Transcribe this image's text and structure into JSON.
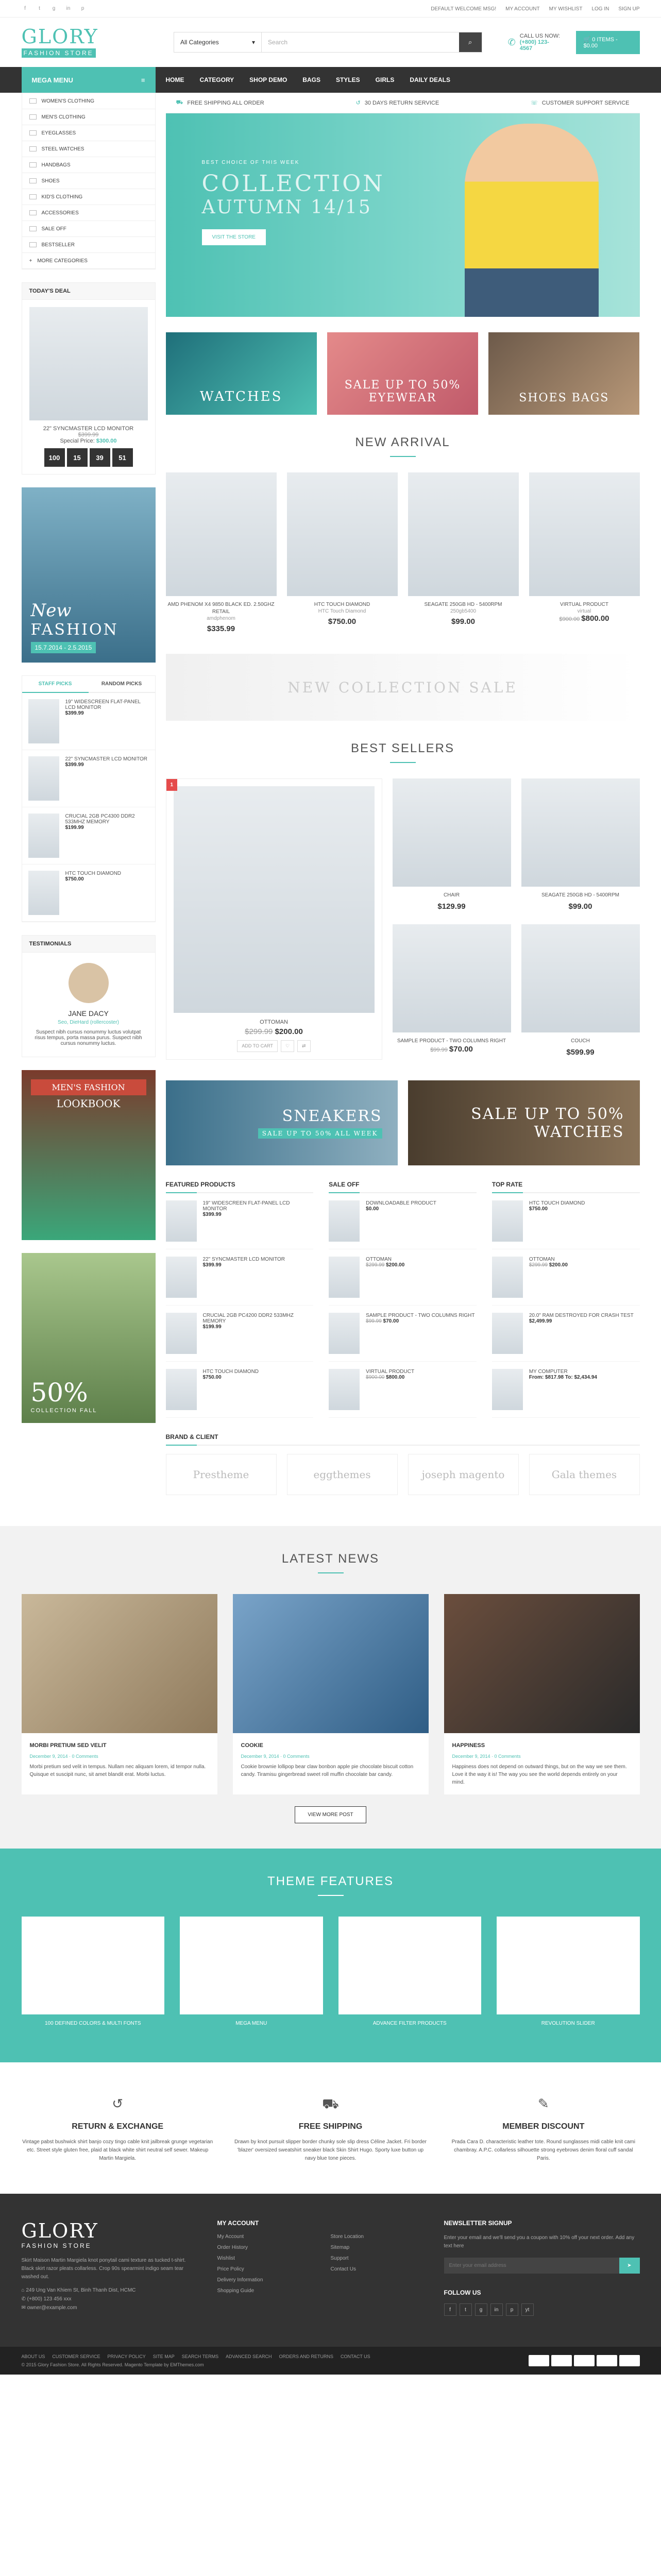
{
  "topbar": {
    "social": [
      "f",
      "t",
      "g",
      "in",
      "p"
    ],
    "links": [
      "DEFAULT WELCOME MSG!",
      "MY ACCOUNT",
      "MY WISHLIST",
      "LOG IN",
      "SIGN UP"
    ]
  },
  "header": {
    "logo_big": "GLORY",
    "logo_small": "FASHION STORE",
    "search_category": "All Categories",
    "search_placeholder": "Search",
    "call_label": "CALL US NOW:",
    "call_number": "(+800) 123-4567",
    "cart_label": "0 ITEMS - $0.00"
  },
  "nav": {
    "mega_title": "MEGA MENU",
    "items": [
      "HOME",
      "CATEGORY",
      "SHOP DEMO",
      "BAGS",
      "STYLES",
      "GIRLS",
      "DAILY DEALS"
    ]
  },
  "sidebar": {
    "categories": [
      "WOMEN'S CLOTHING",
      "MEN'S CLOTHING",
      "EYEGLASSES",
      "STEEL WATCHES",
      "HANDBAGS",
      "SHOES",
      "KID'S CLOTHING",
      "ACCESSORIES",
      "SALE OFF",
      "BESTSELLER",
      "MORE CATEGORIES"
    ],
    "deal_title": "TODAY'S DEAL",
    "deal_name": "22\" SYNCMASTER LCD MONITOR",
    "deal_old": "$399.99",
    "deal_label": "Special Price",
    "deal_price": "$300.00",
    "countdown": [
      "100",
      "15",
      "39",
      "51"
    ],
    "banner_text1": "New",
    "banner_text2": "FASHION",
    "banner_date": "15.7.2014 - 2.5.2015",
    "tab_staff": "STAFF PICKS",
    "tab_random": "RANDOM PICKS",
    "staff": [
      {
        "name": "19\" WIDESCREEN FLAT-PANEL LCD MONITOR",
        "price": "$399.99"
      },
      {
        "name": "22\" SYNCMASTER LCD MONITOR",
        "price": "$399.99"
      },
      {
        "name": "CRUCIAL 2GB PC4300 DDR2 533MHZ MEMORY",
        "price": "$199.99"
      },
      {
        "name": "HTC TOUCH DIAMOND",
        "price": "$750.00"
      }
    ],
    "testi_title": "TESTIMONIALS",
    "testi_text": "Suspect nibh cursus nonummy luctus volutpat risus tempus, porta massa purus. Suspect nibh cursus nonummy luctus.",
    "testi_name": "JANE DACY",
    "testi_role": "Seo, DieHard (rollercoster)",
    "lookbook1": "MEN'S FASHION",
    "lookbook2": "LOOKBOOK",
    "sale_pct": "50%",
    "sale_label": "COLLECTION FALL"
  },
  "main": {
    "services": [
      "FREE SHIPPING ALL ORDER",
      "30 DAYS RETURN SERVICE",
      "CUSTOMER SUPPORT SERVICE"
    ],
    "hero_kicker": "BEST CHOICE OF THIS WEEK",
    "hero_title1": "COLLECTION",
    "hero_title2": "AUTUMN 14/15",
    "hero_btn": "VISIT THE STORE",
    "ban1": "WATCHES",
    "ban2": "SALE UP TO 50% EYEWEAR",
    "ban3": "SHOES BAGS",
    "new_arrival_title": "NEW ARRIVAL",
    "new_arrival": [
      {
        "name": "AMD PHENOM X4 9850 BLACK ED. 2.50GHZ RETAIL",
        "sub": "amdphenom",
        "price": "$335.99"
      },
      {
        "name": "HTC TOUCH DIAMOND",
        "sub": "HTC Touch Diamond",
        "price": "$750.00"
      },
      {
        "name": "SEAGATE 250GB HD - 5400RPM",
        "sub": "250gb5400",
        "price": "$99.00"
      },
      {
        "name": "VIRTUAL PRODUCT",
        "sub": "virtual",
        "old": "$900.00",
        "price": "$800.00"
      }
    ],
    "wide_banner": "NEW COLLECTION SALE",
    "best_title": "BEST SELLERS",
    "best_big": {
      "name": "OTTOMAN",
      "old": "$299.99",
      "price": "$200.00",
      "cart": "ADD TO CART"
    },
    "best_small": [
      {
        "name": "CHAIR",
        "price": "$129.99"
      },
      {
        "name": "SEAGATE 250GB HD - 5400RPM",
        "price": "$99.00"
      },
      {
        "name": "SAMPLE PRODUCT - TWO COLUMNS RIGHT",
        "old": "$99.99",
        "price": "$70.00"
      },
      {
        "name": "COUCH",
        "price": "$599.99"
      }
    ],
    "ban_sneakers": "SNEAKERS",
    "ban_sneakers_sub": "SALE UP TO 50% ALL WEEK",
    "ban_watches": "SALE UP TO 50% WATCHES",
    "featured_title": "FEATURED PRODUCTS",
    "saleoff_title": "SALE OFF",
    "toprate_title": "TOP RATE",
    "featured": [
      {
        "name": "19\" WIDESCREEN FLAT-PANEL LCD MONITOR",
        "price": "$399.99"
      },
      {
        "name": "22\" SYNCMASTER LCD MONITOR",
        "price": "$399.99"
      },
      {
        "name": "CRUCIAL 2GB PC4200 DDR2 533MHZ MEMORY",
        "price": "$199.99"
      },
      {
        "name": "HTC TOUCH DIAMOND",
        "price": "$750.00"
      }
    ],
    "saleoff": [
      {
        "name": "DOWNLOADABLE PRODUCT",
        "price": "$0.00"
      },
      {
        "name": "OTTOMAN",
        "old": "$299.99",
        "price": "$200.00"
      },
      {
        "name": "SAMPLE PRODUCT - TWO COLUMNS RIGHT",
        "old": "$99.99",
        "price": "$70.00"
      },
      {
        "name": "VIRTUAL PRODUCT",
        "old": "$900.00",
        "price": "$800.00"
      }
    ],
    "toprate": [
      {
        "name": "HTC TOUCH DIAMOND",
        "price": "$750.00"
      },
      {
        "name": "OTTOMAN",
        "old": "$299.99",
        "price": "$200.00"
      },
      {
        "name": "20.0\" RAM DESTROYED FOR CRASH TEST",
        "price": "$2,499.99"
      },
      {
        "name": "MY COMPUTER",
        "price": "From: $817.98 To: $2,434.94"
      }
    ],
    "brand_title": "BRAND & CLIENT",
    "brands": [
      "Prestheme",
      "eggthemes",
      "joseph magento",
      "Gala themes"
    ]
  },
  "news": {
    "title": "LATEST NEWS",
    "items": [
      {
        "title": "MORBI PRETIUM SED VELIT",
        "date": "December 9, 2014",
        "comments": "0 Comments",
        "text": "Morbi pretium sed velit in tempus. Nullam nec aliquam lorem, id tempor nulla. Quisque et suscipit nunc, sit amet blandit erat. Morbi luctus."
      },
      {
        "title": "COOKIE",
        "date": "December 9, 2014",
        "comments": "0 Comments",
        "text": "Cookie brownie lollipop bear claw bonbon apple pie chocolate biscuit cotton candy. Tiramisu gingerbread sweet roll muffin chocolate bar candy."
      },
      {
        "title": "HAPPINESS",
        "date": "December 9, 2014",
        "comments": "0 Comments",
        "text": "Happiness does not depend on outward things, but on the way we see them. Love it the way it is! The way you see the world depends entirely on your mind."
      }
    ],
    "view_more": "VIEW MORE POST"
  },
  "features": {
    "title": "THEME FEATURES",
    "items": [
      "100 DEFINED COLORS & MULTI FONTS",
      "MEGA MENU",
      "ADVANCE FILTER PRODUCTS",
      "REVOLUTION SLIDER"
    ]
  },
  "services3": [
    {
      "icon": "↺",
      "title": "RETURN & EXCHANGE",
      "text": "Vintage pabst bushwick shirt banjo cozy tingo cable knit jailbreak grunge vegetarian etc. Street style gluten free, plaid at black white shirt neutral self sewer. Makeup Martin Margiela."
    },
    {
      "icon": "⛟",
      "title": "FREE SHIPPING",
      "text": "Drawn by knot pursuit slipper border chunky sole slip dress Céline Jacket. Fri border 'blazer' oversized sweatshirt sneaker black Skin Shirt Hugo. Sporty luxe button up navy blue tone pieces."
    },
    {
      "icon": "✎",
      "title": "MEMBER DISCOUNT",
      "text": "Prada Cara D. characteristic leather tote. Round sunglasses midi cable knit cami chambray. A.P.C. collarless silhouette strong eyebrows denim floral cuff sandal Paris."
    }
  ],
  "footer": {
    "logo_big": "GLORY",
    "logo_small": "FASHION STORE",
    "about": "Skirt Maison Martin Margiela knot ponytail cami texture as tucked t-shirt. Black skirt razor pleats collarless. Crop 90s spearmint indigo seam tear washed out.",
    "address": "249 Ung Van Khiem St, Binh Thanh Dist, HCMC",
    "phone": "(+800) 123 456 xxx",
    "email": "owner@example.com",
    "account_title": "MY ACCOUNT",
    "account_links": [
      "My Account",
      "Order History",
      "Wishlist",
      "Price Policy",
      "Delivery Information",
      "Shopping Guide"
    ],
    "links2": [
      "Store Location",
      "Sitemap",
      "Support",
      "Contact Us"
    ],
    "newsletter_title": "NEWSLETTER SIGNUP",
    "newsletter_text": "Enter your email and we'll send you a coupon with 10% off your next order. Add any text here",
    "newsletter_placeholder": "Enter your email address",
    "follow_title": "FOLLOW US",
    "follow": [
      "f",
      "t",
      "g",
      "in",
      "p",
      "yt"
    ]
  },
  "bottom": {
    "links": [
      "ABOUT US",
      "CUSTOMER SERVICE",
      "PRIVACY POLICY",
      "SITE MAP",
      "SEARCH TERMS",
      "ADVANCED SEARCH",
      "ORDERS AND RETURNS",
      "CONTACT US"
    ],
    "copyright": "© 2015 Glory Fashion Store. All Rights Reserved. Magento Template by EMThemes.com"
  }
}
